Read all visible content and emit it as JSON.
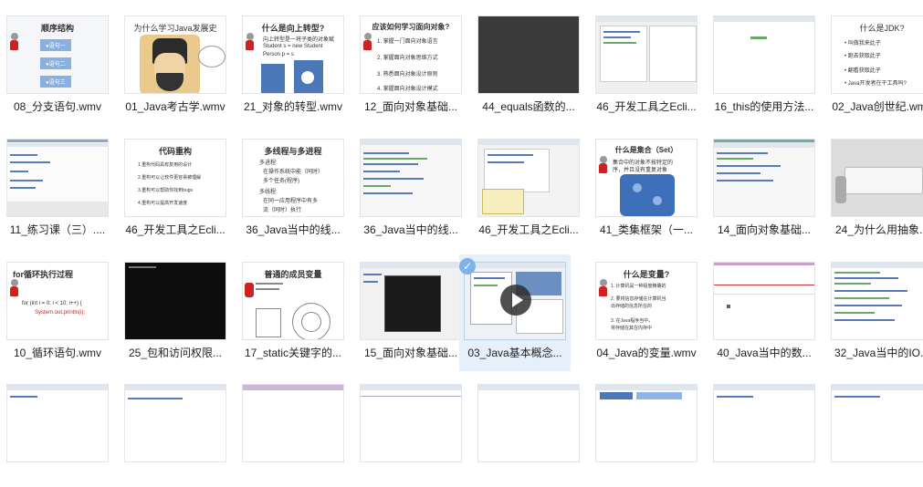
{
  "tiles": [
    {
      "label": "08_分支语句.wmv",
      "slide_title": "顺序结构",
      "slide_lines": [
        "●语句一",
        "●语句二",
        "●语句三"
      ]
    },
    {
      "label": "01_Java考古学.wmv",
      "slide_title": "为什么学习Java发展史"
    },
    {
      "label": "21_对象的转型.wmv",
      "slide_title": "什么是向上转型?",
      "slide_lines": [
        "向上转型是一将子类的对象赋",
        "Student s = new Student",
        "Person p = s"
      ]
    },
    {
      "label": "12_面向对象基础...",
      "slide_title": "应该如何学习面向对象?",
      "slide_lines": [
        "1. 掌握一门面向对象语言",
        "2. 掌握面向对象思维方式",
        "3. 熟悉面向对象设计原则",
        "4. 掌握面向对象设计模式"
      ]
    },
    {
      "label": "44_equals函数的..."
    },
    {
      "label": "46_开发工具之Ecli..."
    },
    {
      "label": "16_this的使用方法..."
    },
    {
      "label": "02_Java创世纪.wmv",
      "slide_title": "什么是JDK?",
      "slide_lines": [
        "• 叫做我来此子",
        "• 跑去获取此子",
        "• 翻看获取此子",
        "• Java开发者在干工具吗?"
      ]
    },
    {
      "label": "11_练习课（三）...."
    },
    {
      "label": "46_开发工具之Ecli...",
      "slide_title": "代码重构",
      "slide_lines": [
        "1.重构代码具有复用的设计",
        "2.重构可以让软件更容易被理解",
        "3.重构可以帮助你找到bugs",
        "4.重构可以提高开发速度"
      ]
    },
    {
      "label": "36_Java当中的线...",
      "slide_title": "多线程与多进程",
      "slide_lines": [
        "多进程:",
        "在操作系统中能（同时）",
        "多个任务(程序)",
        "多线程:",
        "在同一应用程序中有多",
        "流（同时）执行"
      ]
    },
    {
      "label": "36_Java当中的线..."
    },
    {
      "label": "46_开发工具之Ecli..."
    },
    {
      "label": "41_类集框架（一...",
      "slide_title": "什么是集合（Set）",
      "slide_lines": [
        "集合中的对象不按特定的",
        "序，并且没有重复对象"
      ]
    },
    {
      "label": "14_面向对象基础..."
    },
    {
      "label": "24_为什么用抽象..."
    },
    {
      "label": "10_循环语句.wmv",
      "slide_title": "for循环执行过程",
      "slide_lines": [
        "for (int i = 0; i < 10; i++) {",
        "System.out.println(i);"
      ]
    },
    {
      "label": "25_包和访问权限..."
    },
    {
      "label": "17_static关键字的...",
      "slide_title": "普通的成员变量"
    },
    {
      "label": "15_面向对象基础..."
    },
    {
      "label": "03_Java基本概念..."
    },
    {
      "label": "04_Java的变量.wmv",
      "slide_title": "什么是变量?",
      "slide_lines": [
        "1. 计算机是一种极度精确的",
        "2. 要将信息存储在计算机当",
        "  出存储的信息所在的",
        "3. 在Java程序当中，",
        "  将存储在其在内存中"
      ]
    },
    {
      "label": "40_Java当中的数..."
    },
    {
      "label": "32_Java当中的IO..."
    },
    {
      "label": ""
    },
    {
      "label": ""
    },
    {
      "label": ""
    },
    {
      "label": ""
    },
    {
      "label": ""
    },
    {
      "label": ""
    },
    {
      "label": ""
    },
    {
      "label": ""
    }
  ],
  "selected_index": 20,
  "accent": "#7fb2e8"
}
